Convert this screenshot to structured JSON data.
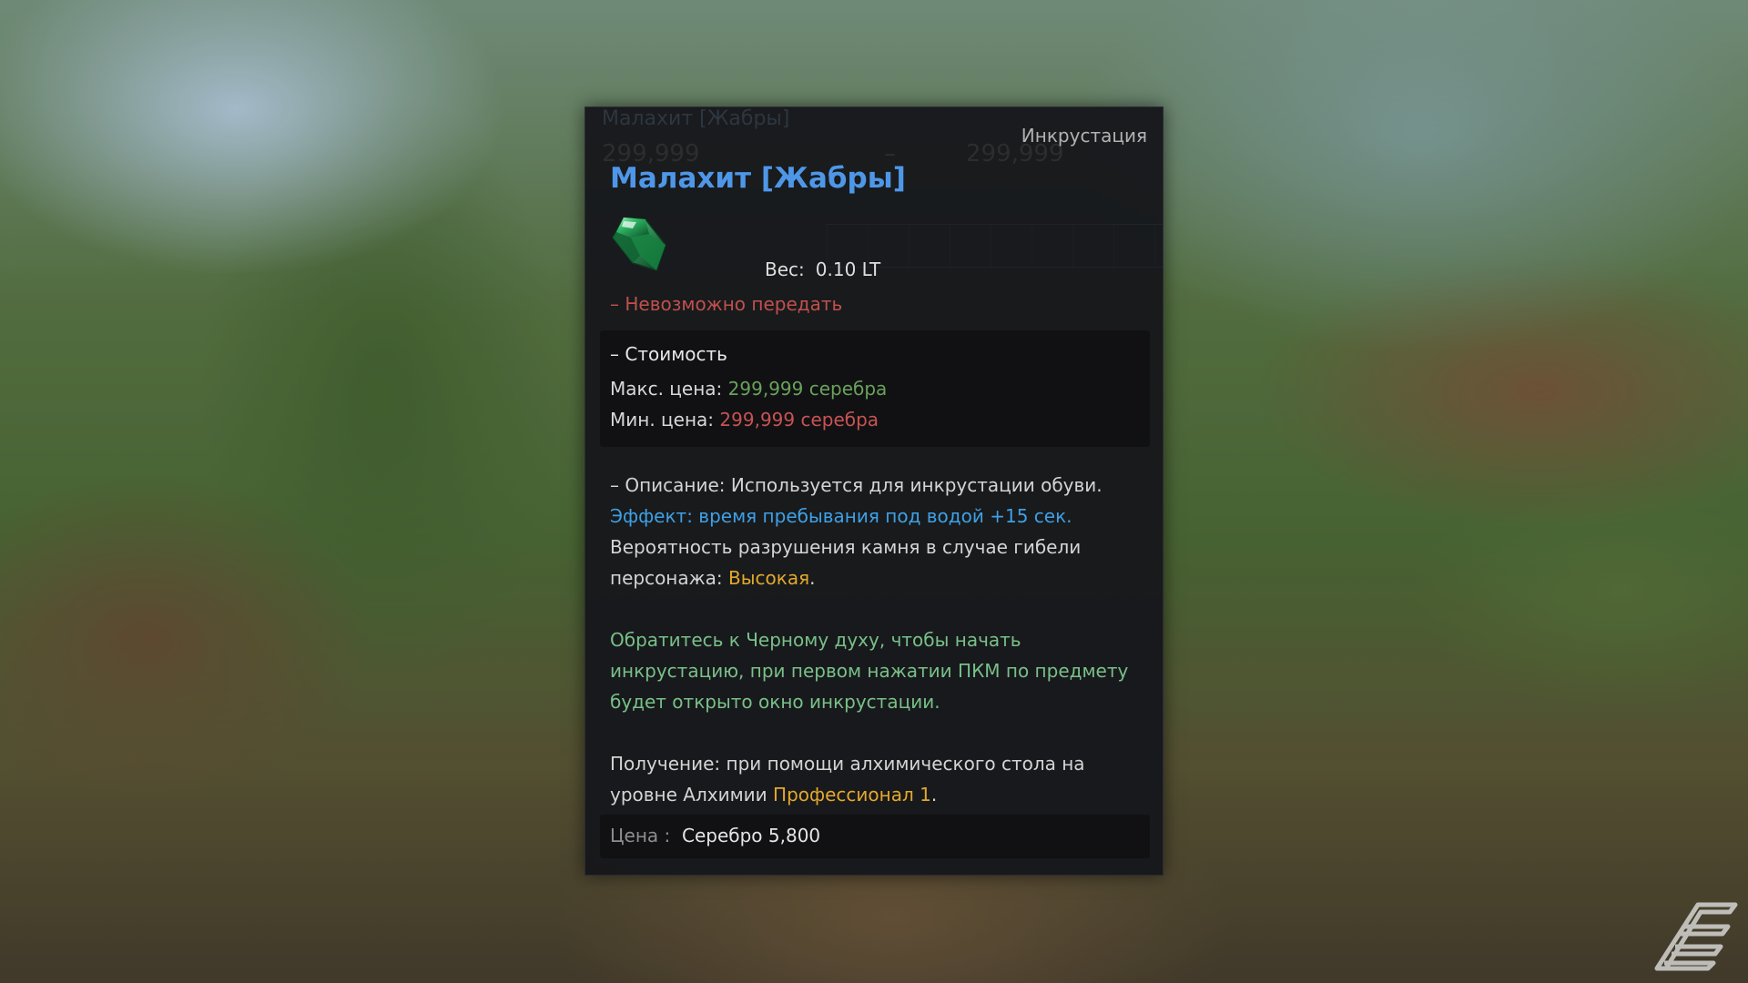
{
  "background": {
    "description_colors": {
      "sky": "#bed7eb",
      "grass": "#5d7b47",
      "ground": "#6e5037"
    }
  },
  "tooltip": {
    "ghost": {
      "title": "Малахит [Жабры]",
      "price_left": "299,999",
      "dash": "–",
      "price_right": "299,999"
    },
    "category": "Инкрустация",
    "title": "Малахит [Жабры]",
    "title_color": "#4e97e8",
    "icon": "green-gem-icon",
    "weight_label": "Вес:",
    "weight_value": "0.10 LT",
    "not_tradable": "– Невозможно передать",
    "cost": {
      "header": "– Стоимость",
      "max_label": "Макс. цена:",
      "max_value": "299,999 серебра",
      "min_label": "Мин. цена:",
      "min_value": "299,999 серебра"
    },
    "description": {
      "line1": "– Описание: Используется для инкрустации обуви.",
      "effect": "Эффект: время пребывания под водой +15 сек.",
      "break_line1": "Вероятность разрушения камня в случае гибели",
      "break_prefix": "персонажа: ",
      "break_value": "Высокая",
      "break_suffix": ".",
      "spirit1": "Обратитесь к Черному духу, чтобы начать",
      "spirit2": "инкрустацию, при первом нажатии ПКМ по предмету",
      "spirit3": "будет открыто окно инкрустации.",
      "obtain1": "Получение: при помощи алхимического стола на",
      "obtain2_prefix": "уровне Алхимии ",
      "obtain2_value": "Профессионал 1",
      "obtain2_suffix": "."
    },
    "price_label": "Цена :",
    "price_value": "Серебро 5,800"
  },
  "colors": {
    "green_price": "#69a25a",
    "red_price": "#c75353",
    "effect_blue": "#3fa0e6",
    "highlight_gold": "#e3a82c",
    "hint_teal": "#78c088"
  },
  "watermark_icon": "site-logo-icon"
}
